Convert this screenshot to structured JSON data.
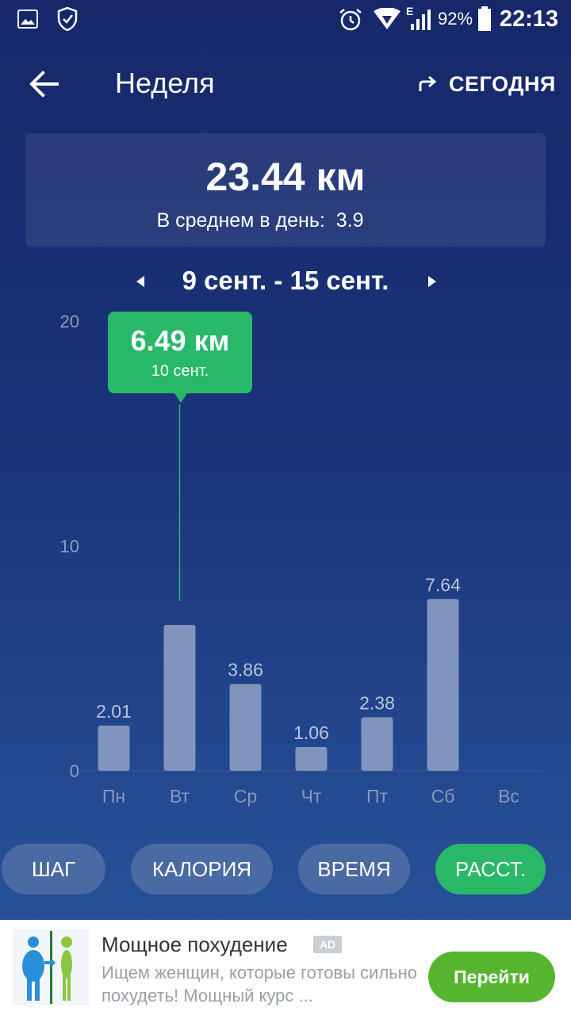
{
  "status_bar": {
    "battery_percent": "92%",
    "time": "22:13",
    "network": "E",
    "icons": [
      "image-icon",
      "shield-check-icon",
      "alarm-icon",
      "wifi-icon",
      "signal-icon",
      "battery-icon"
    ]
  },
  "header": {
    "title": "Неделя",
    "today_label": "СЕГОДНЯ",
    "back_icon": "arrow-left-icon",
    "today_icon": "redo-arrow-icon"
  },
  "summary": {
    "total": "23.44 км",
    "avg_label": "В среднем в день:",
    "avg_value": "3.9"
  },
  "week_nav": {
    "range": "9 сент. - 15 сент."
  },
  "tooltip": {
    "value": "6.49 км",
    "date": "10 сент."
  },
  "chart_data": {
    "type": "bar",
    "categories": [
      "Пн",
      "Вт",
      "Ср",
      "Чт",
      "Пт",
      "Сб",
      "Вс"
    ],
    "values": [
      2.01,
      6.49,
      3.86,
      1.06,
      2.38,
      7.64,
      0
    ],
    "value_labels": [
      "2.01",
      "",
      "3.86",
      "1.06",
      "2.38",
      "7.64",
      ""
    ],
    "yticks": [
      "20",
      "10",
      "0"
    ],
    "ylim": [
      0,
      20
    ],
    "selected_index": 1,
    "colors": {
      "bar": "#8194bd",
      "axis_text": "#8a9bc2",
      "highlight": "#27b868"
    }
  },
  "metrics": {
    "items": [
      "ШАГ",
      "КАЛОРИЯ",
      "ВРЕМЯ",
      "РАССТ."
    ],
    "active_index": 3
  },
  "ad": {
    "title": "Мощное похудение",
    "badge": "AD",
    "description": "Ищем женщин, которые готовы сильно похудеть! Мощный курс ...",
    "button": "Перейти"
  },
  "colors": {
    "accent_green": "#29b866",
    "pill_inactive": "#4a6aa3",
    "ad_button": "#56b52e"
  }
}
